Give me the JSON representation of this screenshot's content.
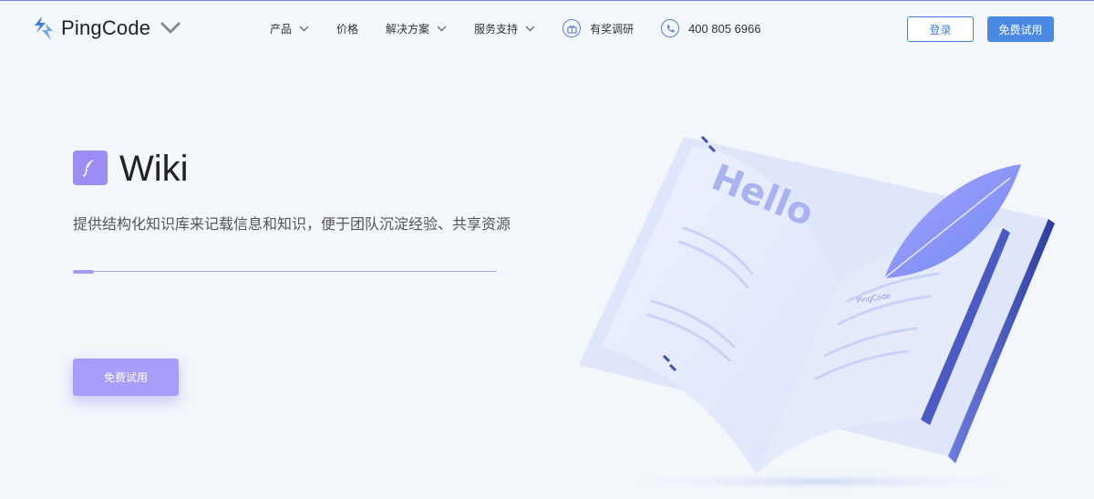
{
  "header": {
    "brand": "PingCode",
    "nav": [
      {
        "label": "产品",
        "dropdown": true
      },
      {
        "label": "价格",
        "dropdown": false
      },
      {
        "label": "解决方案",
        "dropdown": true
      },
      {
        "label": "服务支持",
        "dropdown": true
      }
    ],
    "survey_label": "有奖调研",
    "phone": "400 805 6966",
    "login_label": "登录",
    "trial_label": "免费试用"
  },
  "hero": {
    "title": "Wiki",
    "description": "提供结构化知识库来记载信息和知识，便于团队沉淀经验、共享资源",
    "trial_label": "免费试用",
    "carousel_progress": 0.05
  },
  "illustration": {
    "page_word": "Hello",
    "page_brand": "PingCode"
  },
  "colors": {
    "accent": "#4a8ae6",
    "brand_purple": "#9c8df5",
    "background": "#f3f6fb"
  },
  "icons": {
    "logo": "pingcode-logo-icon",
    "wiki": "wiki-feather-icon",
    "survey": "gift-icon",
    "phone": "phone-icon",
    "chevron": "chevron-down-icon"
  }
}
